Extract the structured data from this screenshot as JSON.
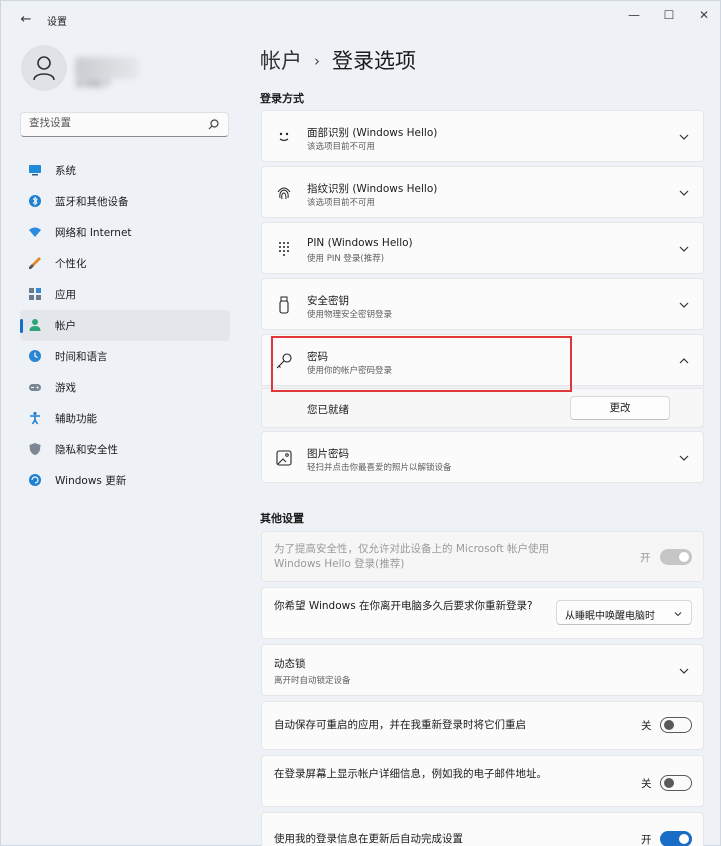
{
  "window": {
    "title": "设置",
    "back_icon": "back-arrow-icon",
    "controls": {
      "minimize": "—",
      "maximize": "☐",
      "close": "✕"
    }
  },
  "profile": {
    "name": "本地帐户"
  },
  "search": {
    "placeholder": "查找设置"
  },
  "sidebar": {
    "items": [
      {
        "label": "系统",
        "icon": "monitor-icon"
      },
      {
        "label": "蓝牙和其他设备",
        "icon": "bluetooth-icon"
      },
      {
        "label": "网络和 Internet",
        "icon": "wifi-icon"
      },
      {
        "label": "个性化",
        "icon": "brush-icon"
      },
      {
        "label": "应用",
        "icon": "apps-icon"
      },
      {
        "label": "帐户",
        "icon": "person-icon",
        "active": true
      },
      {
        "label": "时间和语言",
        "icon": "globe-clock-icon"
      },
      {
        "label": "游戏",
        "icon": "gamepad-icon"
      },
      {
        "label": "辅助功能",
        "icon": "accessibility-icon"
      },
      {
        "label": "隐私和安全性",
        "icon": "shield-icon"
      },
      {
        "label": "Windows 更新",
        "icon": "update-icon"
      }
    ]
  },
  "breadcrumb": {
    "parent": "帐户",
    "separator": "›",
    "current": "登录选项"
  },
  "sign_in": {
    "section_title": "登录方式",
    "options": [
      {
        "title": "面部识别 (Windows Hello)",
        "subtitle": "该选项目前不可用",
        "icon": "face-icon"
      },
      {
        "title": "指纹识别 (Windows Hello)",
        "subtitle": "该选项目前不可用",
        "icon": "fingerprint-icon"
      },
      {
        "title": "PIN (Windows Hello)",
        "subtitle": "使用 PIN 登录(推荐)",
        "icon": "pin-keypad-icon"
      },
      {
        "title": "安全密钥",
        "subtitle": "使用物理安全密钥登录",
        "icon": "usb-key-icon"
      },
      {
        "title": "密码",
        "subtitle": "使用你的帐户密码登录",
        "icon": "key-icon",
        "expanded": true
      },
      {
        "title": "图片密码",
        "subtitle": "轻扫并点击你最喜爱的照片以解锁设备",
        "icon": "picture-icon"
      }
    ],
    "password_status": "您已就绪",
    "change_button": "更改"
  },
  "other": {
    "section_title": "其他设置",
    "hello_only": {
      "text": "为了提高安全性，仅允许对此设备上的 Microsoft 帐户使用 Windows Hello 登录(推荐)",
      "state": "开",
      "disabled": true
    },
    "require_signin": {
      "text": "你希望 Windows 在你离开电脑多久后要求你重新登录?",
      "value": "从睡眠中唤醒电脑时"
    },
    "dynamic_lock": {
      "title": "动态锁",
      "subtitle": "离开时自动锁定设备"
    },
    "restart_apps": {
      "text": "自动保存可重启的应用，并在我重新登录时将它们重启",
      "state": "关"
    },
    "show_details": {
      "text": "在登录屏幕上显示帐户详细信息，例如我的电子邮件地址。",
      "state": "关"
    },
    "use_signin_info": {
      "text": "使用我的登录信息在更新后自动完成设置",
      "state": "开"
    }
  },
  "colors": {
    "accent": "#1a6dc7",
    "highlight_box": "#e0383a"
  }
}
